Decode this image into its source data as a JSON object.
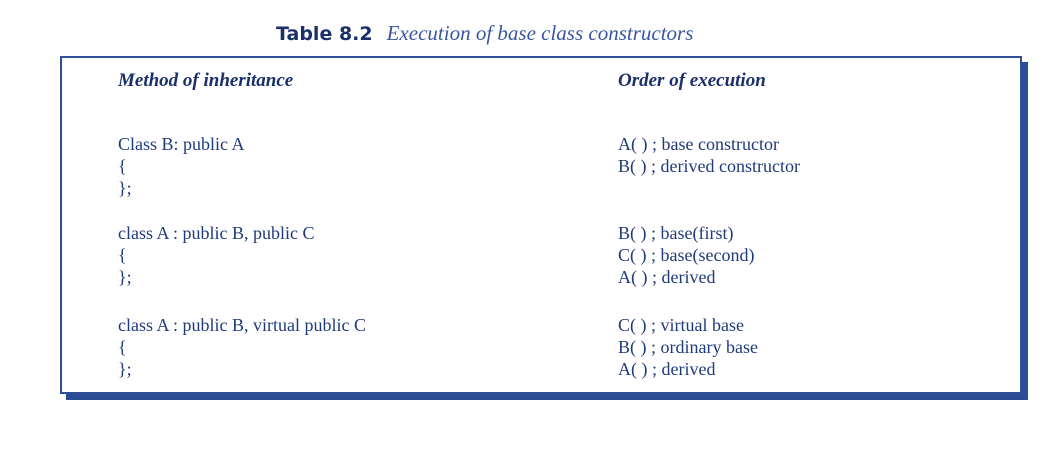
{
  "caption": {
    "label": "Table 8.2",
    "text": "Execution of  base class constructors"
  },
  "table": {
    "headers": {
      "method": "Method of inheritance",
      "order": "Order of execution"
    },
    "rows": [
      {
        "method": [
          "Class B: public A",
          "{",
          "};"
        ],
        "order": [
          "A( ) ; base constructor",
          "B( ) ; derived constructor"
        ]
      },
      {
        "method": [
          "class A : public B, public C",
          "{",
          "};"
        ],
        "order": [
          "B( ) ; base(first)",
          "C( ) ; base(second)",
          "A( ) ; derived"
        ]
      },
      {
        "method": [
          "class A : public B, virtual public C",
          "{",
          "};"
        ],
        "order": [
          "C( ) ; virtual base",
          "B( ) ; ordinary base",
          "A( ) ; derived"
        ]
      }
    ]
  }
}
